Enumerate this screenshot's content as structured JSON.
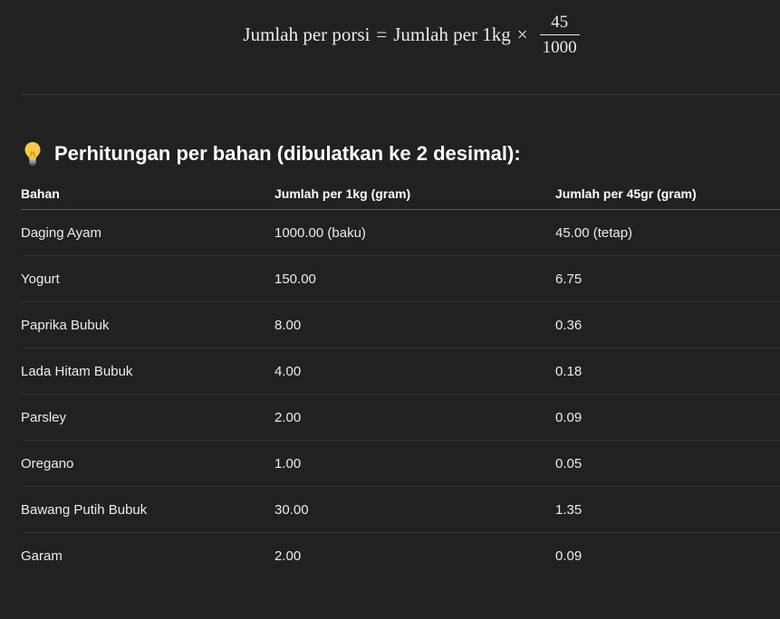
{
  "formula": {
    "lhs": "Jumlah per porsi",
    "equals": "=",
    "rhs": "Jumlah per 1kg",
    "times": "×",
    "numerator": "45",
    "denominator": "1000"
  },
  "section": {
    "icon": "lightbulb-icon",
    "title": "Perhitungan per bahan (dibulatkan ke 2 desimal):"
  },
  "table": {
    "headers": [
      "Bahan",
      "Jumlah per 1kg (gram)",
      "Jumlah per 45gr (gram)"
    ],
    "rows": [
      [
        "Daging Ayam",
        "1000.00 (baku)",
        "45.00 (tetap)"
      ],
      [
        "Yogurt",
        "150.00",
        "6.75"
      ],
      [
        "Paprika Bubuk",
        "8.00",
        "0.36"
      ],
      [
        "Lada Hitam Bubuk",
        "4.00",
        "0.18"
      ],
      [
        "Parsley",
        "2.00",
        "0.09"
      ],
      [
        "Oregano",
        "1.00",
        "0.05"
      ],
      [
        "Bawang Putih Bubuk",
        "30.00",
        "1.35"
      ],
      [
        "Garam",
        "2.00",
        "0.09"
      ]
    ]
  },
  "colors": {
    "background": "#212121",
    "text": "#ececec",
    "bulb": "#f7c948"
  }
}
